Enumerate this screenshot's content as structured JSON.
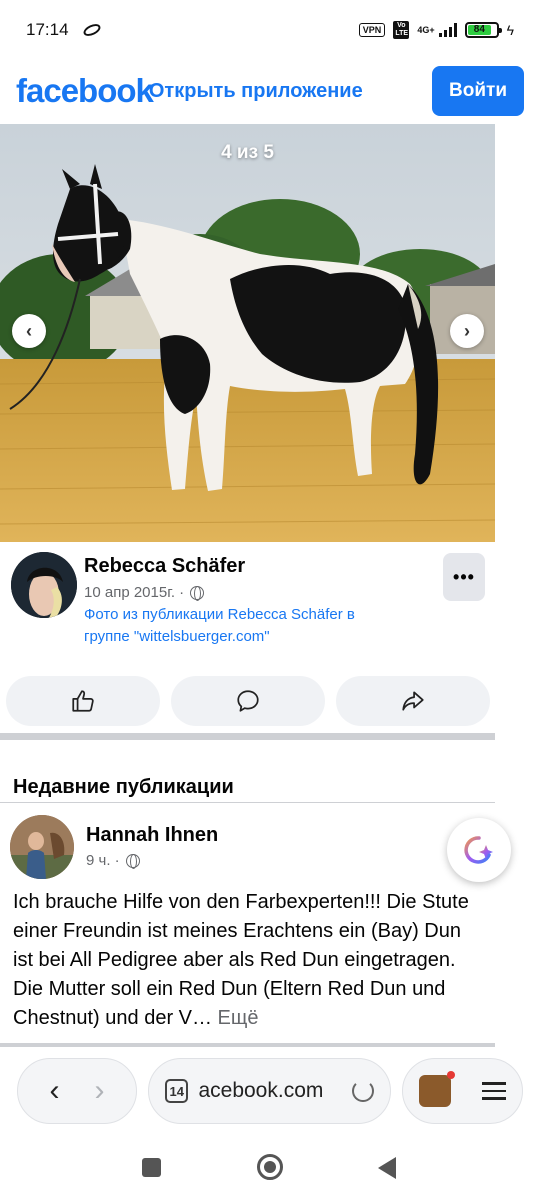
{
  "status_bar": {
    "time": "17:14",
    "vpn": "VPN",
    "volte": "Vo LTE",
    "network": "4G+",
    "battery": "84"
  },
  "header": {
    "logo": "facebook",
    "open_app": "Открыть приложение",
    "login": "Войти"
  },
  "photo": {
    "counter": "4 из 5",
    "prev_icon": "chevron-left-icon",
    "next_icon": "chevron-right-icon"
  },
  "post": {
    "author": "Rebecca Schäfer",
    "date": "10 апр 2015г. ·",
    "source": "Фото из публикации Rebecca Schäfer в группе \"wittelsbuerger.com\"",
    "more": "•••"
  },
  "actions": {
    "like_icon": "thumbs-up-icon",
    "comment_icon": "comment-icon",
    "share_icon": "share-icon"
  },
  "recent": {
    "title": "Недавние публикации",
    "author": "Hannah Ihnen",
    "time": "9 ч. ·",
    "text": "Ich brauche Hilfe von den Farbexperten!!! Die Stute einer Freundin ist meines Erachtens ein (Bay) Dun ist bei All Pedigree aber als Red Dun eingetragen. Die Mutter soll ein Red Dun (Eltern Red Dun und Chestnut) und der V…",
    "see_more": " Ещё"
  },
  "browser": {
    "back": "‹",
    "forward": "›",
    "tab_count": "14",
    "url": "acebook.com"
  },
  "colors": {
    "brand": "#1877f2",
    "button_bg": "#f0f2f5",
    "divider": "#ced0d4"
  }
}
